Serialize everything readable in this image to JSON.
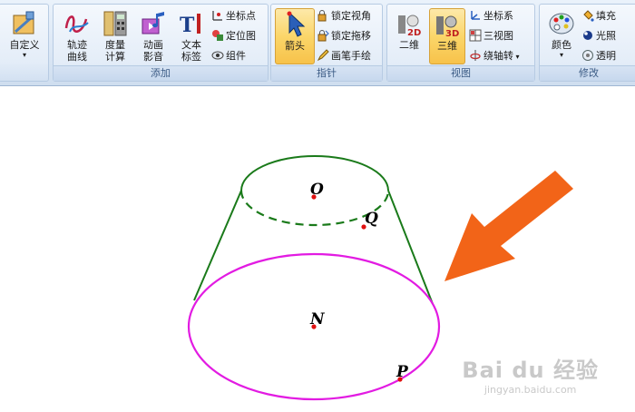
{
  "ribbon": {
    "g0": {
      "custom_label": "自定义"
    },
    "add": {
      "group_label": "添加",
      "trace": "轨迹\n曲线",
      "measure": "度量\n计算",
      "animation": "动画\n影音",
      "text": "文本\n标签",
      "coordpoint": "坐标点",
      "locate": "定位图",
      "component": "组件"
    },
    "pointer": {
      "group_label": "指针",
      "arrow": "箭头",
      "lock_view": "锁定视角",
      "lock_drag": "锁定拖移",
      "brush": "画笔手绘"
    },
    "view": {
      "group_label": "视图",
      "twod": "二维",
      "threed": "三维",
      "axes": "坐标系",
      "three_view": "三视图",
      "rotate": "绕轴转"
    },
    "modify": {
      "group_label": "修改",
      "color": "颜色",
      "fill": "填充",
      "light": "光照",
      "transparent": "透明"
    }
  },
  "canvas": {
    "labels": {
      "O": "O",
      "Q": "Q",
      "N": "N",
      "P": "P"
    },
    "colors": {
      "top_circle": "#1a7a1a",
      "bottom_ellipse": "#e21be2",
      "points": "#e01010",
      "arrow": "#f26418"
    }
  },
  "watermark": {
    "main": "Bai du 经验",
    "sub": "jingyan.baidu.com"
  }
}
